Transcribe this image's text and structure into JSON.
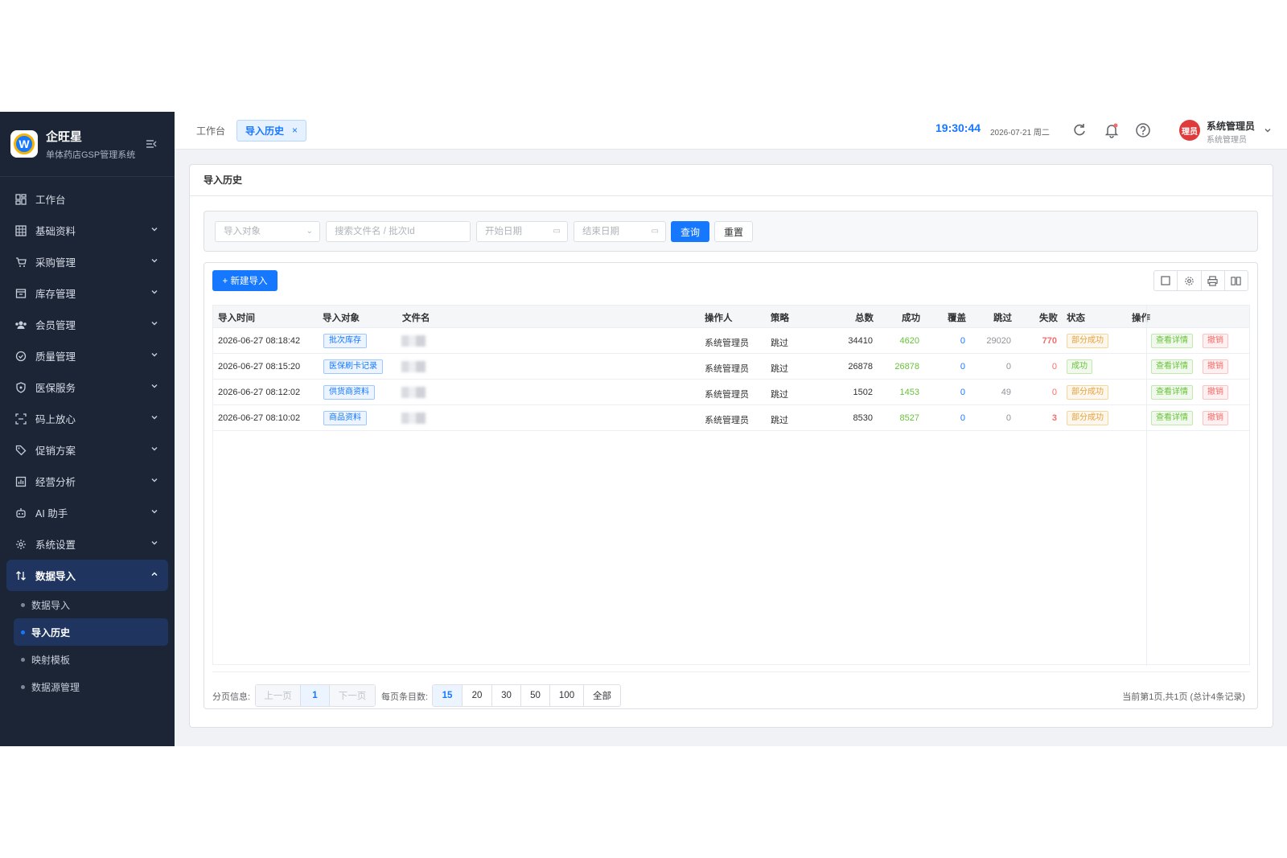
{
  "brand": {
    "title": "企旺星",
    "subtitle": "单体药店GSP管理系统",
    "logo_letter": "W"
  },
  "sidebar": {
    "items": [
      {
        "label": "工作台",
        "icon": "dashboard-icon",
        "has_children": false
      },
      {
        "label": "基础资料",
        "icon": "grid-icon",
        "has_children": true
      },
      {
        "label": "采购管理",
        "icon": "cart-icon",
        "has_children": true
      },
      {
        "label": "库存管理",
        "icon": "box-icon",
        "has_children": true
      },
      {
        "label": "会员管理",
        "icon": "users-icon",
        "has_children": true
      },
      {
        "label": "质量管理",
        "icon": "check-circle-icon",
        "has_children": true
      },
      {
        "label": "医保服务",
        "icon": "shield-icon",
        "has_children": true
      },
      {
        "label": "码上放心",
        "icon": "scan-icon",
        "has_children": true
      },
      {
        "label": "促销方案",
        "icon": "tag-icon",
        "has_children": true
      },
      {
        "label": "经营分析",
        "icon": "chart-icon",
        "has_children": true
      },
      {
        "label": "AI 助手",
        "icon": "robot-icon",
        "has_children": true
      },
      {
        "label": "系统设置",
        "icon": "gear-icon",
        "has_children": true
      },
      {
        "label": "数据导入",
        "icon": "import-icon",
        "has_children": true,
        "open": true
      }
    ],
    "sub_items": [
      {
        "label": "数据导入",
        "active": false
      },
      {
        "label": "导入历史",
        "active": true
      },
      {
        "label": "映射模板",
        "active": false
      },
      {
        "label": "数据源管理",
        "active": false
      }
    ]
  },
  "topbar": {
    "tab_home": "工作台",
    "tab_active": "导入历史",
    "tab_close": "×",
    "clock": "19:30:44",
    "date": "2026-07-21 周二",
    "avatar_text": "理员",
    "user_name": "系统管理员",
    "user_role": "系统管理员"
  },
  "panel": {
    "title": "导入历史"
  },
  "filter": {
    "object_placeholder": "导入对象",
    "search_placeholder": "搜索文件名 / 批次Id",
    "start_placeholder": "开始日期",
    "end_placeholder": "结束日期",
    "query_label": "查询",
    "reset_label": "重置"
  },
  "toolbar": {
    "new_label": "+ 新建导入"
  },
  "table": {
    "headers": {
      "time": "导入时间",
      "object": "导入对象",
      "file": "文件名",
      "operator": "操作人",
      "strategy": "策略",
      "total": "总数",
      "success": "成功",
      "overwrite": "覆盖",
      "skip": "跳过",
      "fail": "失败",
      "status": "状态",
      "action": "操作"
    },
    "rows": [
      {
        "time": "2026-06-27 08:18:42",
        "object": "批次库存",
        "operator": "系统管理员",
        "strategy": "跳过",
        "total": "34410",
        "success": "4620",
        "overwrite": "0",
        "skip": "29020",
        "fail": "770",
        "status": "部分成功",
        "status_kind": "partial",
        "view": "查看详情",
        "undo": "撤销"
      },
      {
        "time": "2026-06-27 08:15:20",
        "object": "医保刷卡记录",
        "operator": "系统管理员",
        "strategy": "跳过",
        "total": "26878",
        "success": "26878",
        "overwrite": "0",
        "skip": "0",
        "fail": "0",
        "status": "成功",
        "status_kind": "success",
        "view": "查看详情",
        "undo": "撤销"
      },
      {
        "time": "2026-06-27 08:12:02",
        "object": "供货商资料",
        "operator": "系统管理员",
        "strategy": "跳过",
        "total": "1502",
        "success": "1453",
        "overwrite": "0",
        "skip": "49",
        "fail": "0",
        "status": "部分成功",
        "status_kind": "partial",
        "view": "查看详情",
        "undo": "撤销"
      },
      {
        "time": "2026-06-27 08:10:02",
        "object": "商品资料",
        "operator": "系统管理员",
        "strategy": "跳过",
        "total": "8530",
        "success": "8527",
        "overwrite": "0",
        "skip": "0",
        "fail": "3",
        "status": "部分成功",
        "status_kind": "partial",
        "view": "查看详情",
        "undo": "撤销"
      }
    ]
  },
  "pager": {
    "info_label": "分页信息:",
    "prev": "上一页",
    "page": "1",
    "next": "下一页",
    "size_label": "每页条目数:",
    "sizes": [
      "15",
      "20",
      "30",
      "50",
      "100",
      "全部"
    ],
    "summary": "当前第1页,共1页 (总计4条记录)"
  },
  "colors": {
    "primary": "#1677ff",
    "sidebar_bg": "#1c2536",
    "success": "#67c23a",
    "danger": "#f56c6c",
    "warning": "#e6a23c"
  }
}
